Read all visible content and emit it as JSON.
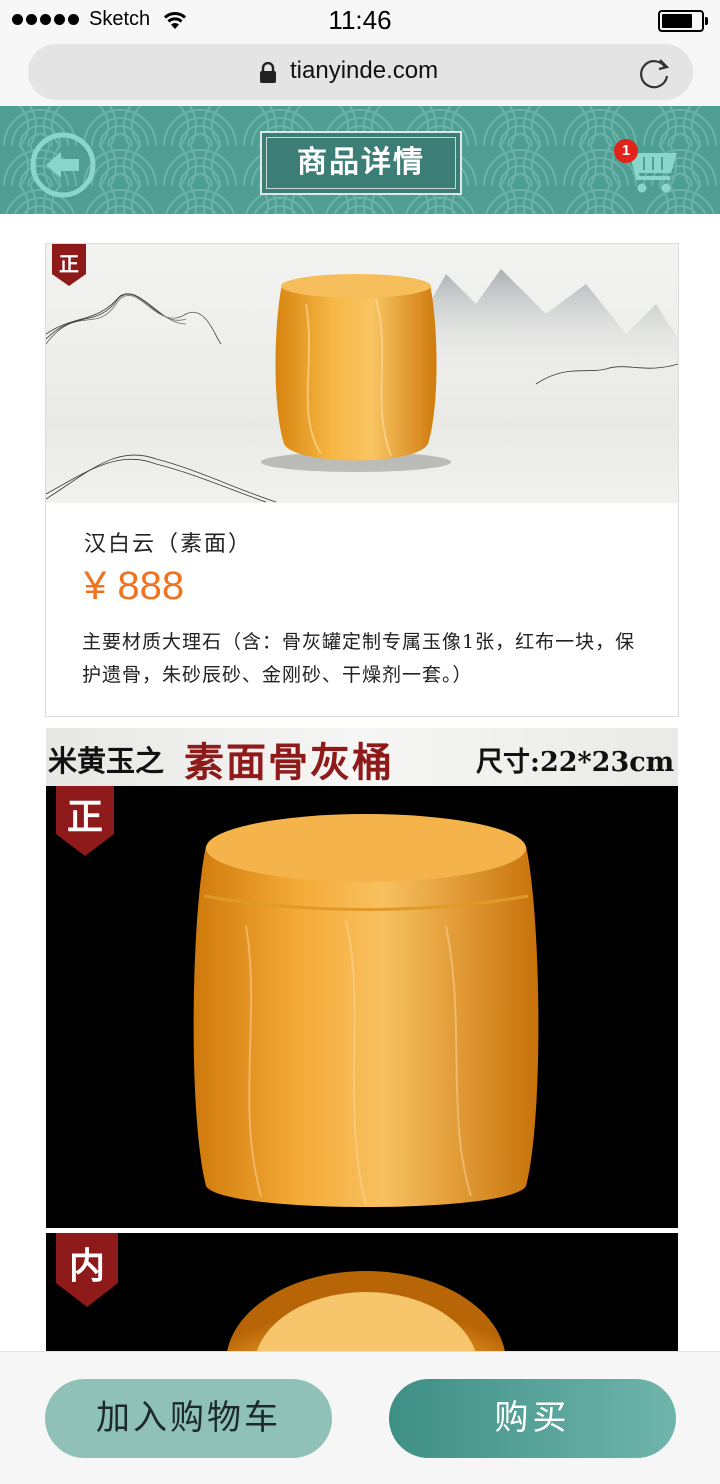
{
  "status_bar": {
    "carrier": "Sketch",
    "time": "11:46",
    "icons": [
      "signal-dots-icon",
      "wifi-icon",
      "battery-icon"
    ]
  },
  "browser": {
    "url": "tianyinde.com",
    "icons": [
      "lock-icon",
      "reload-icon"
    ]
  },
  "header": {
    "title": "商品详情",
    "back_icon": "back-arrow-icon",
    "cart_icon": "cart-icon",
    "cart_count": "1",
    "colors": {
      "teal": "#4f9e93",
      "dark_teal": "#3c7e76",
      "badge": "#e2231a"
    }
  },
  "product": {
    "tag": "正",
    "name": "汉白云（素面）",
    "price": "¥ 888",
    "description": "主要材质大理石（含：骨灰罐定制专属玉像1张，红布一块，保护遗骨，朱砂辰砂、金刚砂、干燥剂一套。）",
    "colors": {
      "price": "#f0731f",
      "tag": "#8f1a1a"
    }
  },
  "detail": {
    "banner_prefix": "米黄玉之",
    "banner_main": "素面骨灰桶",
    "banner_size": "尺寸:22*23cm",
    "front_tag": "正",
    "inner_tag": "内"
  },
  "actions": {
    "add_to_cart": "加入购物车",
    "buy": "购买"
  }
}
